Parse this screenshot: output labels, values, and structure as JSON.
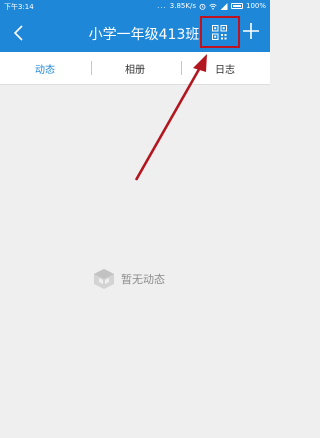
{
  "status_bar": {
    "time": "下午3:14",
    "dots": "...",
    "network_speed": "3.85K/s",
    "battery": "100%"
  },
  "header": {
    "back_icon": "chevron-left-icon",
    "title": "小学一年级413班",
    "qr_icon": "qr-code-icon",
    "add_icon": "plus-icon",
    "highlight_color": "#c1121f"
  },
  "tabs": [
    {
      "label": "动态",
      "active": true
    },
    {
      "label": "相册",
      "active": false
    },
    {
      "label": "日志",
      "active": false
    }
  ],
  "empty_state": {
    "icon": "empty-box-icon",
    "text": "暂无动态"
  },
  "colors": {
    "accent": "#1e87d8",
    "annotation": "#c1121f"
  }
}
